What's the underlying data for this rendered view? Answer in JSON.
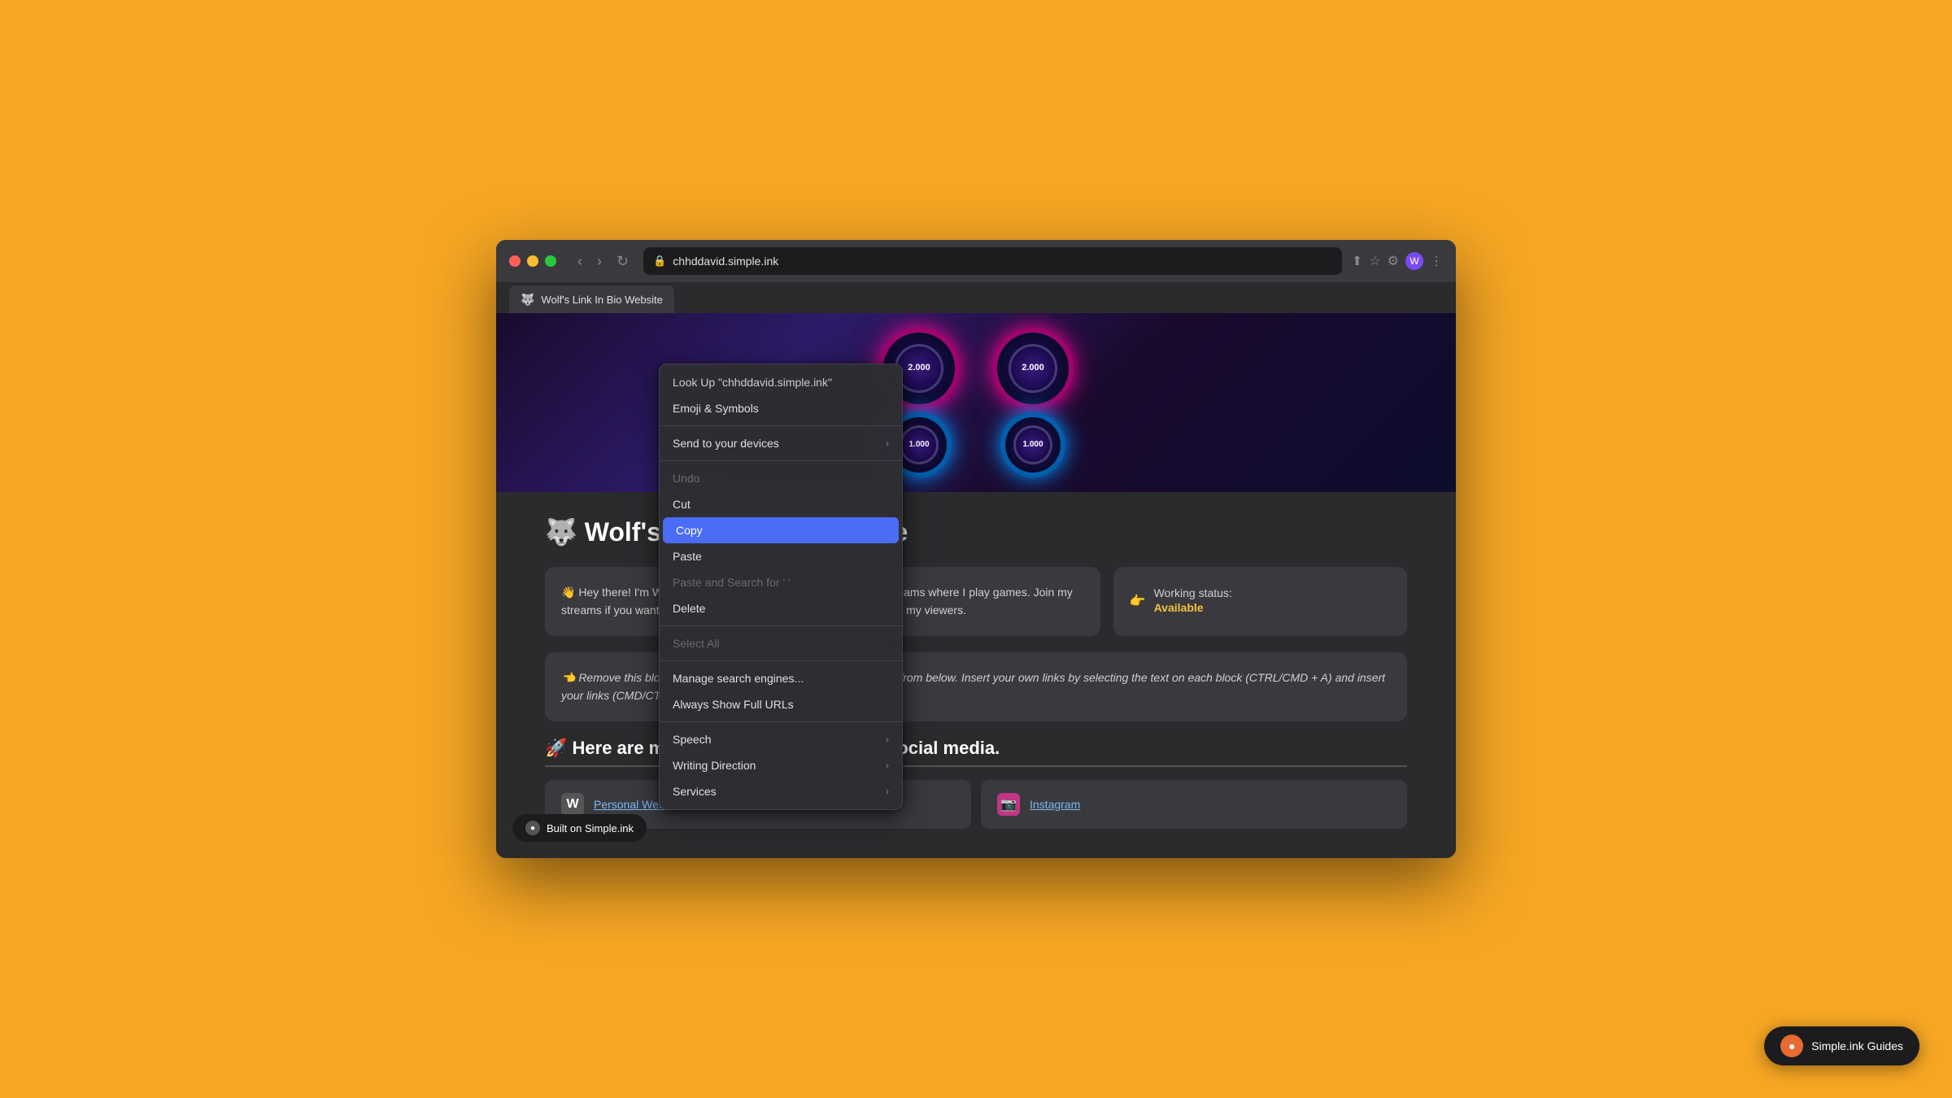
{
  "browser": {
    "url": "chhddavid.simple.ink",
    "tab_label": "Wolf's Link In Bio Website",
    "tab_favicon": "🐺"
  },
  "context_menu": {
    "items": [
      {
        "id": "lookup",
        "label": "Look Up \"chhddavid.simple.ink\"",
        "disabled": false,
        "highlighted": false,
        "has_submenu": false
      },
      {
        "id": "emoji",
        "label": "Emoji & Symbols",
        "disabled": false,
        "highlighted": false,
        "has_submenu": false
      },
      {
        "id": "sep1",
        "type": "separator"
      },
      {
        "id": "send_devices",
        "label": "Send to your devices",
        "disabled": false,
        "highlighted": false,
        "has_submenu": true
      },
      {
        "id": "sep2",
        "type": "separator"
      },
      {
        "id": "undo",
        "label": "Undo",
        "disabled": true,
        "highlighted": false,
        "has_submenu": false
      },
      {
        "id": "cut",
        "label": "Cut",
        "disabled": false,
        "highlighted": false,
        "has_submenu": false
      },
      {
        "id": "copy",
        "label": "Copy",
        "disabled": false,
        "highlighted": true,
        "has_submenu": false
      },
      {
        "id": "paste",
        "label": "Paste",
        "disabled": false,
        "highlighted": false,
        "has_submenu": false
      },
      {
        "id": "paste_search",
        "label": "Paste and Search for ' '",
        "disabled": false,
        "highlighted": false,
        "has_submenu": false
      },
      {
        "id": "delete",
        "label": "Delete",
        "disabled": false,
        "highlighted": false,
        "has_submenu": false
      },
      {
        "id": "sep3",
        "type": "separator"
      },
      {
        "id": "select_all",
        "label": "Select All",
        "disabled": false,
        "highlighted": false,
        "has_submenu": false
      },
      {
        "id": "sep4",
        "type": "separator"
      },
      {
        "id": "manage_search",
        "label": "Manage search engines...",
        "disabled": false,
        "highlighted": false,
        "has_submenu": false
      },
      {
        "id": "show_full_urls",
        "label": "Always Show Full URLs",
        "disabled": false,
        "highlighted": false,
        "has_submenu": false
      },
      {
        "id": "sep5",
        "type": "separator"
      },
      {
        "id": "speech",
        "label": "Speech",
        "disabled": false,
        "highlighted": false,
        "has_submenu": true
      },
      {
        "id": "writing_dir",
        "label": "Writing Direction",
        "disabled": false,
        "highlighted": false,
        "has_submenu": true
      },
      {
        "id": "services",
        "label": "Services",
        "disabled": false,
        "highlighted": false,
        "has_submenu": true
      }
    ]
  },
  "page": {
    "title": "🐺 Wolf's Link In Bio Website",
    "bio_text": "👋 Hey there! I'm Wolf and I am a Twitch streamer. I make daily streams where I play games. Join my streams if you want to have fun! I do lots of interactive activities with my viewers.",
    "working_status_label": "Working status:",
    "working_status_value": "Available",
    "remove_block_text": "👈 Remove this block: You can remove any social media you want from below. Insert your own links by selecting the text on each block (CTRL/CMD + A) and insert your links (CMD/CTRL + K) then press enter.",
    "social_title": "🚀 Here are my most important links on social media.",
    "links": [
      {
        "icon": "W",
        "label": "Personal Website"
      },
      {
        "icon": "📷",
        "label": "Instagram"
      }
    ]
  },
  "badges": {
    "built_on": "Built on Simple.ink",
    "guides": "Simple.ink Guides"
  },
  "arcade": {
    "score1": "2.000",
    "score2": "1.000",
    "score3": "2.000",
    "score4": "1.000"
  }
}
